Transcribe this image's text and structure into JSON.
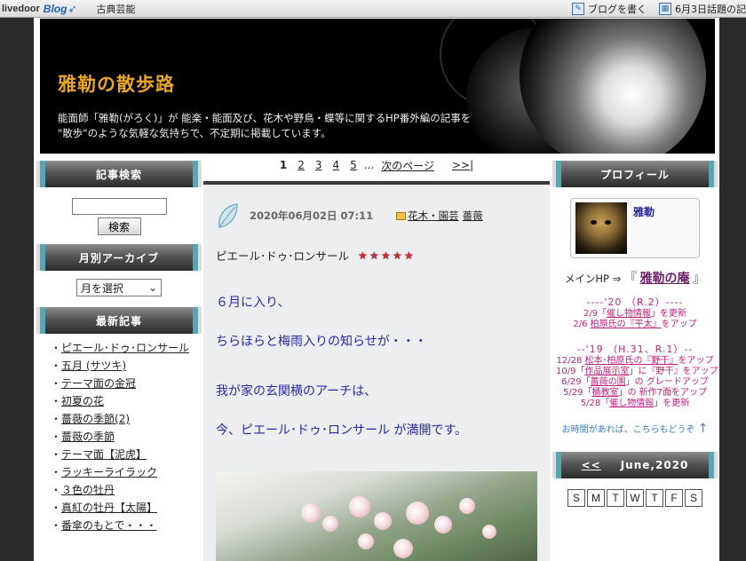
{
  "topbar": {
    "logo_text": "livedoor",
    "logo_blog": "Blog",
    "category": "古典芸能",
    "write_blog": "ブログを書く",
    "topic": "6月3日話題の記"
  },
  "header": {
    "title": "雅勒の散歩路",
    "desc_line1": "能面師「雅勒(がろく)」が 能楽・能面及び、花木や野鳥・蝶等に関するHP番外編の記事を",
    "desc_line2": "\"散歩\"のような気軽な気持ちで、不定期に掲載しています。"
  },
  "sidebar_left": {
    "search_title": "記事検索",
    "search_button": "検索",
    "search_value": "",
    "archive_title": "月別アーカイブ",
    "month_select": "月を選択",
    "recent_title": "最新記事",
    "recent_items": [
      "ピエール･ドゥ･ロンサール",
      "五月 (サツキ)",
      "テーマ面の金冠",
      "初夏の花",
      "薔薇の季節(2)",
      "薔薇の季節",
      "テーマ面【泥虎】",
      "ラッキーライラック",
      "３色の牡丹",
      "真紅の牡丹【太陽】",
      "番傘のもとで・・・"
    ]
  },
  "pager": {
    "pages": [
      "1",
      "2",
      "3",
      "4",
      "5"
    ],
    "current": "1",
    "ellipsis": "...",
    "next": "次のページ",
    "last": ">>|"
  },
  "article": {
    "date": "2020年06月02日 07:11",
    "category": "花木・園芸",
    "tag": "薔薇",
    "title": "ピエール･ドゥ･ロンサール",
    "rating": 5,
    "body": [
      "６月に入り、",
      "ちらほらと梅雨入りの知らせが・・・",
      "我が家の玄関横のアーチは、",
      "今、ピエール･ドゥ･ロンサール が満開です。"
    ]
  },
  "sidebar_right": {
    "profile_title": "プロフィール",
    "profile_name": "雅勒",
    "mainhp_label": "メインHP ⇒",
    "mainhp_open": "『",
    "mainhp_link": "雅勒の庵",
    "mainhp_close": "』",
    "news_2020_heading": "----'20 （R.2）----",
    "news_2020": [
      {
        "pre": "2/9「",
        "link": "催し物情報",
        "post": "」を更新"
      },
      {
        "pre": "2/6 ",
        "link": "柏原氏の『平太』",
        "post": "をアップ"
      }
    ],
    "news_2019_heading": "--'19 （H.31、R.1）--",
    "news_2019": [
      {
        "pre": "12/28 ",
        "link": "松本･柏原氏の『野干』",
        "post": "をアップ"
      },
      {
        "pre": "10/9「",
        "link": "作品展示室",
        "post": "」に『野干』をアップ"
      },
      {
        "pre": "6/29「",
        "link": "薔薇の園",
        "post": "」の グレードアップ"
      },
      {
        "pre": "5/29「",
        "link": "桶教室",
        "post": "」の 新作7面をアップ"
      },
      {
        "pre": "5/28「",
        "link": "催し物情報",
        "post": "」を更新"
      }
    ],
    "more_text": "お時間があれば、こちらもどうぞ",
    "more_arrow": "↑",
    "calendar_prev": "<<",
    "calendar_title": "June,2020",
    "weekdays": [
      "S",
      "M",
      "T",
      "W",
      "T",
      "F",
      "S"
    ]
  }
}
